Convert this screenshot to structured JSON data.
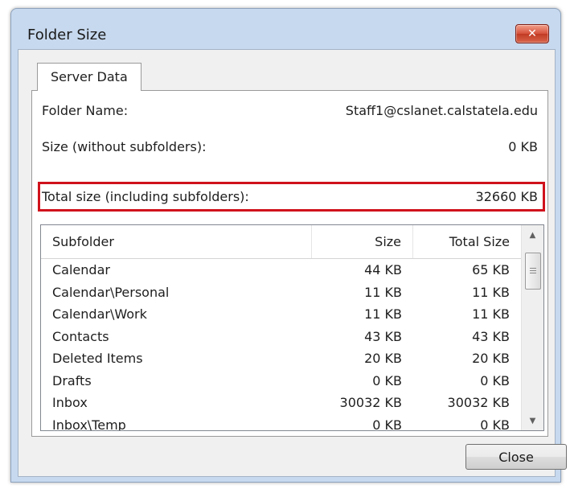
{
  "window": {
    "title": "Folder Size",
    "close_glyph": "✕"
  },
  "tabs": [
    {
      "label": "Server Data",
      "selected": true
    }
  ],
  "info": {
    "folder_name_label": "Folder Name:",
    "folder_name_value": "Staff1@cslanet.calstatela.edu",
    "size_label": "Size (without subfolders):",
    "size_value": "0 KB",
    "total_label": "Total size (including subfolders):",
    "total_value": "32660 KB"
  },
  "table": {
    "headers": {
      "name": "Subfolder",
      "size": "Size",
      "total": "Total Size"
    },
    "rows": [
      {
        "name": "Calendar",
        "size": "44 KB",
        "total": "65 KB"
      },
      {
        "name": "Calendar\\Personal",
        "size": "11 KB",
        "total": "11 KB"
      },
      {
        "name": "Calendar\\Work",
        "size": "11 KB",
        "total": "11 KB"
      },
      {
        "name": "Contacts",
        "size": "43 KB",
        "total": "43 KB"
      },
      {
        "name": "Deleted Items",
        "size": "20 KB",
        "total": "20 KB"
      },
      {
        "name": "Drafts",
        "size": "0 KB",
        "total": "0 KB"
      },
      {
        "name": "Inbox",
        "size": "30032 KB",
        "total": "30032 KB"
      },
      {
        "name": "Inbox\\Temp",
        "size": "0 KB",
        "total": "0 KB"
      }
    ]
  },
  "buttons": {
    "close_label": "Close"
  },
  "colors": {
    "highlight_border": "#d0121c",
    "window_frame": "#c7d9ee",
    "close_button_red": "#c13a23"
  }
}
